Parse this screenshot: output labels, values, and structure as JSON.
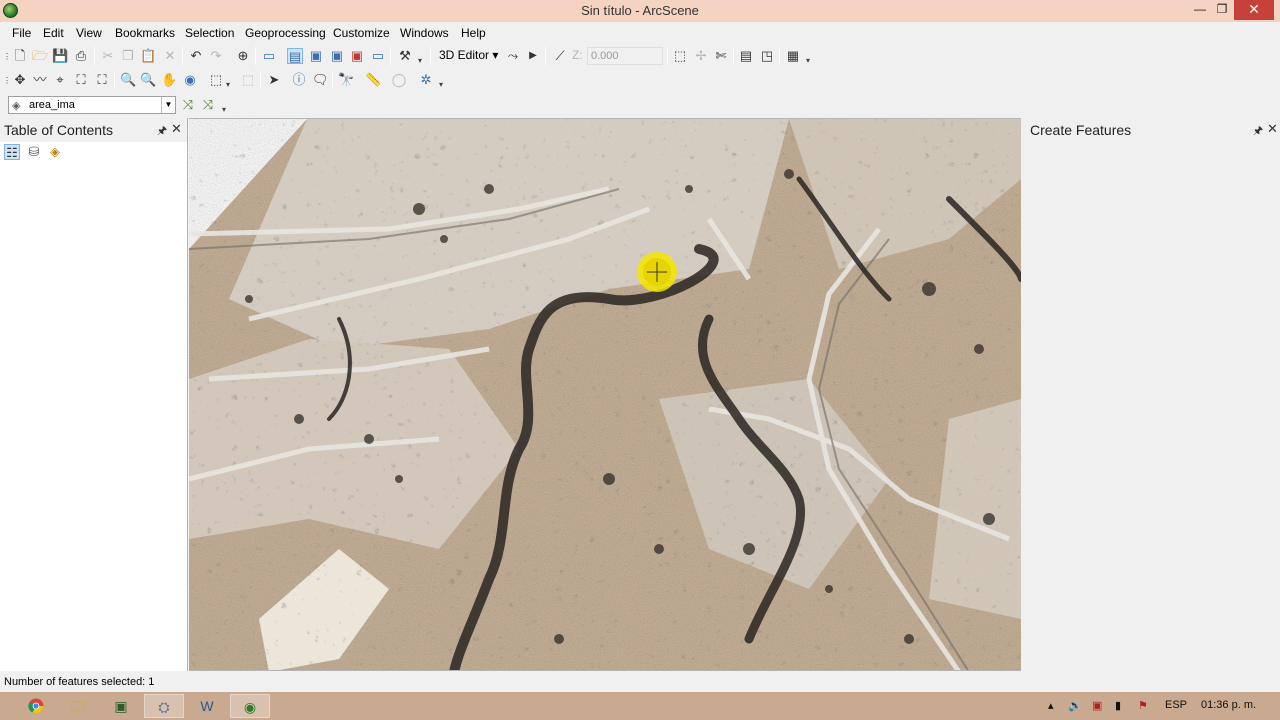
{
  "window": {
    "title": "Sin título - ArcScene",
    "min_glyph": "—",
    "max_glyph": "❐",
    "close_glyph": "✕"
  },
  "menu": [
    "File",
    "Edit",
    "View",
    "Bookmarks",
    "Selection",
    "Geoprocessing",
    "Customize",
    "Windows",
    "Help"
  ],
  "toolbar": {
    "editor_label": "3D Editor ▾",
    "z_label": "Z:",
    "z_value": "0.000"
  },
  "layer_dropdown": {
    "value": "area_ima"
  },
  "toc": {
    "title": "Table of Contents"
  },
  "create_features": {
    "title": "Create Features"
  },
  "status": {
    "text": "Number of features selected: 1"
  },
  "taskbar": {
    "language": "ESP",
    "time": "01:36 p. m."
  },
  "icons": {
    "pin": "🖈",
    "close": "✕"
  }
}
